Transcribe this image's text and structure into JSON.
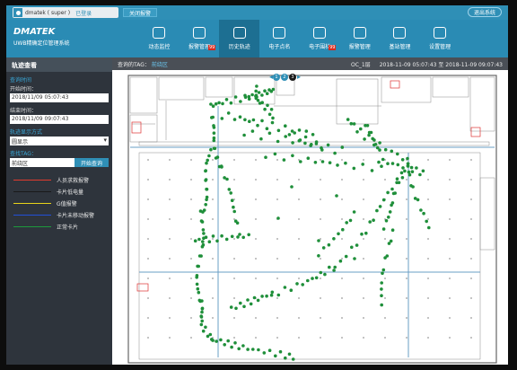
{
  "topbar": {
    "user": "dmatek ( super )",
    "logout": "已登录",
    "close_alarm": "关闭报警",
    "exit": "退出系统"
  },
  "brand": {
    "name": "DMATEK",
    "subtitle": "UWB精确定位管理系统"
  },
  "nav": [
    {
      "label": "动态监控",
      "active": false,
      "badge": ""
    },
    {
      "label": "报警管理",
      "active": false,
      "badge": "99"
    },
    {
      "label": "历史轨迹",
      "active": true,
      "badge": ""
    },
    {
      "label": "电子点名",
      "active": false,
      "badge": ""
    },
    {
      "label": "电子围栏",
      "active": false,
      "badge": "99"
    },
    {
      "label": "报警管理",
      "active": false,
      "badge": ""
    },
    {
      "label": "基站管理",
      "active": false,
      "badge": ""
    },
    {
      "label": "设置管理",
      "active": false,
      "badge": ""
    }
  ],
  "sidebar": {
    "title": "轨迹查看",
    "query_label": "查询时间",
    "start_label": "开始时间：",
    "start_value": "2018/11/09 05:07:43",
    "end_label": "结束时间：",
    "end_value": "2018/11/09 09:07:43",
    "display_label": "轨迹显示方式",
    "display_value": "圆显示",
    "tag_label": "查找TAG：",
    "tag_value": "前绕区",
    "query_button": "开始查询",
    "legend": [
      {
        "label": "人员求救报警",
        "color": "#e23b2e"
      },
      {
        "label": "卡片低电量",
        "color": "#1a1a1a"
      },
      {
        "label": "G值报警",
        "color": "#e8d21a"
      },
      {
        "label": "卡片未移动报警",
        "color": "#2250d8"
      },
      {
        "label": "正常卡片",
        "color": "#1d9a3c"
      }
    ]
  },
  "main": {
    "query_tag_label": "查询的TAG：",
    "query_tag_value": "前绕区",
    "map_name": "OC_1层",
    "time_range": "2018-11-09 05:07:43 至 2018-11-09 09:07:43",
    "playback": [
      "1",
      "2",
      "3"
    ],
    "track_color": "#1f8f3a"
  }
}
